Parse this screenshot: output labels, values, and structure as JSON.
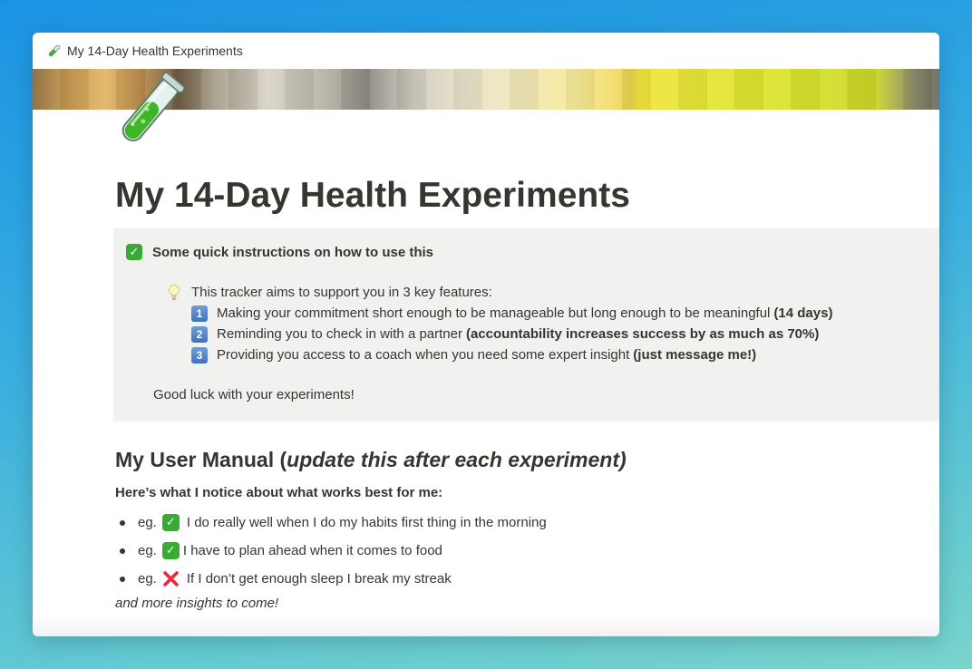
{
  "window": {
    "tab_title": "My 14-Day Health Experiments",
    "tab_icon": "test-tube-icon"
  },
  "page": {
    "icon": "test-tube-icon",
    "title": "My 14-Day Health Experiments"
  },
  "callout": {
    "icon": "check-mark-icon",
    "heading": "Some quick instructions on how to use this",
    "tip_icon": "light-bulb-icon",
    "tip_intro": "This tracker aims to support you in 3 key features:",
    "features": [
      {
        "number": "1",
        "text": "Making your commitment short enough to be manageable but long enough to be meaningful",
        "bold": "(14 days)"
      },
      {
        "number": "2",
        "text": "Reminding you to check in with a partner",
        "bold": "(accountability increases success by as much as 70%)"
      },
      {
        "number": "3",
        "text": "Providing you access to a coach when you need some expert insight",
        "bold": "(just message me!)"
      }
    ],
    "closing": "Good luck with your experiments!"
  },
  "manual": {
    "heading": "My User Manual (",
    "heading_italic": "update this after each experiment)",
    "subheading": "Here’s what I notice about what works best for me:",
    "items": [
      {
        "prefix": "eg.",
        "icon": "check-mark-icon",
        "text": "I do really well when I do my habits first thing in the morning"
      },
      {
        "prefix": "eg.",
        "icon": "check-mark-icon",
        "text": "I have to plan ahead when it comes to food"
      },
      {
        "prefix": "eg.",
        "icon": "cross-mark-icon",
        "text": "If I don’t get enough sleep I break my streak"
      }
    ],
    "footer": "and more insights to come!"
  },
  "colors": {
    "text": "#37352f",
    "callout_bg": "#f1f1ef",
    "check_green": "#3aaa35",
    "cross_red": "#e0303a",
    "number_key_blue": "#4a7fc6"
  }
}
